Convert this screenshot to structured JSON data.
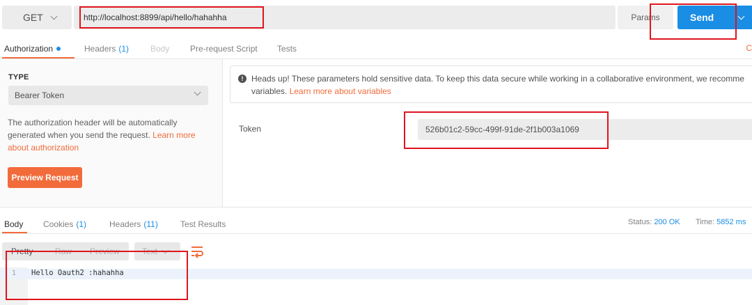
{
  "request": {
    "method": "GET",
    "url": "http://localhost:8899/api/hello/hahahha",
    "params_label": "Params",
    "send_label": "Send"
  },
  "request_tabs": [
    {
      "label": "Authorization"
    },
    {
      "label": "Headers",
      "count": "(1)"
    },
    {
      "label": "Body"
    },
    {
      "label": "Pre-request Script"
    },
    {
      "label": "Tests"
    }
  ],
  "request_tabs_overflow": "C",
  "auth": {
    "type_label": "TYPE",
    "type_value": "Bearer Token",
    "description_1": "The authorization header will be automatically",
    "description_2": "generated when you send the request. ",
    "description_link_1": "Learn more",
    "description_link_2": "about authorization",
    "preview_button": "Preview Request",
    "notice_lead": "Heads up!",
    "notice_text": " These parameters hold sensitive data. To keep this data secure while working in a collaborative environment, we recomme",
    "notice_text_2": "variables. ",
    "notice_link": "Learn more about variables",
    "token_label": "Token",
    "token_value": "526b01c2-59cc-499f-91de-2f1b003a1069"
  },
  "response_tabs": [
    {
      "label": "Body"
    },
    {
      "label": "Cookies",
      "count": "(1)"
    },
    {
      "label": "Headers",
      "count": "(11)"
    },
    {
      "label": "Test Results"
    }
  ],
  "status": {
    "status_label": "Status:",
    "status_value": "200 OK",
    "time_label": "Time:",
    "time_value": "5852 ms"
  },
  "format": {
    "pretty": "Pretty",
    "raw": "Raw",
    "preview": "Preview",
    "type": "Text"
  },
  "response_body": {
    "line_number": "1",
    "line_text": "Hello Oauth2 :hahahha"
  },
  "colors": {
    "accent_orange": "#f26b3a",
    "send_blue": "#1a8de4",
    "annotation_red": "#e0141e"
  }
}
